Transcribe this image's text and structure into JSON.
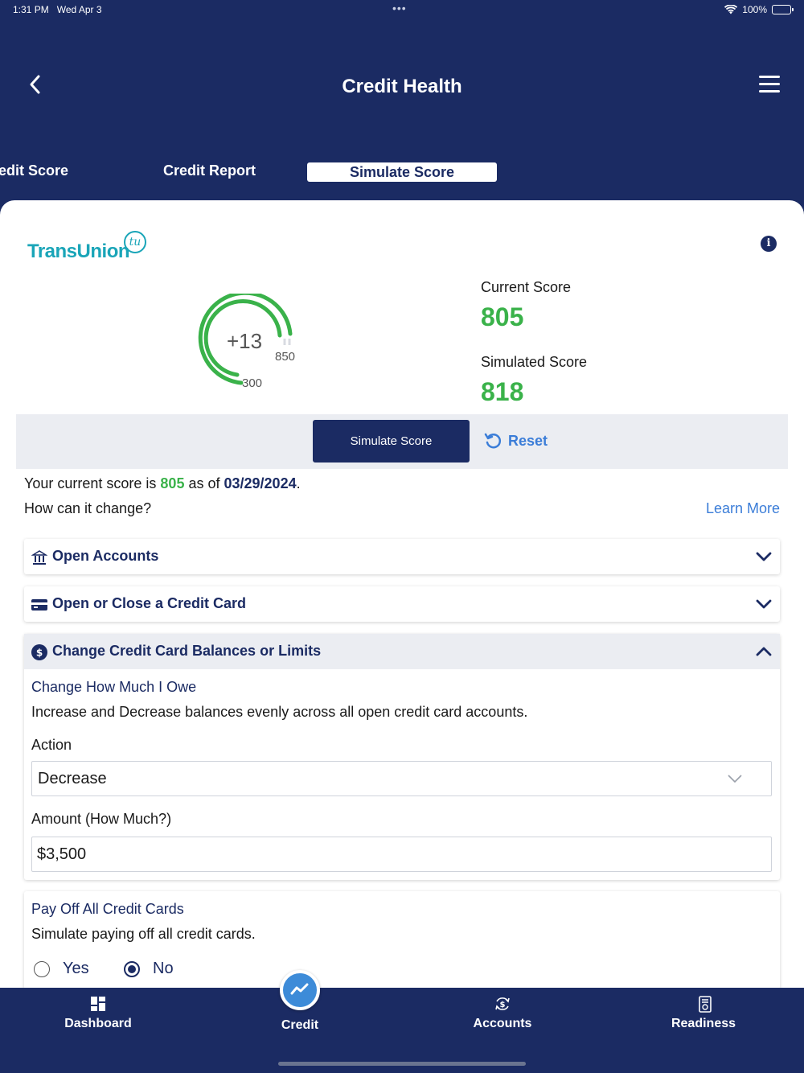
{
  "status": {
    "time": "1:31 PM",
    "date": "Wed Apr 3",
    "battery": "100%"
  },
  "header": {
    "title": "Credit Health"
  },
  "tabs": [
    {
      "label": "Credit Score"
    },
    {
      "label": "Credit Report"
    },
    {
      "label": "Simulate Score"
    }
  ],
  "brand": {
    "name": "TransUnion",
    "badge": "tu",
    "color": "#1aa5b8"
  },
  "gauge": {
    "delta": "+13",
    "max": "850",
    "min": "300"
  },
  "scores": {
    "current_label": "Current Score",
    "current_value": "805",
    "simulated_label": "Simulated Score",
    "simulated_value": "818"
  },
  "actions": {
    "simulate": "Simulate Score",
    "reset": "Reset"
  },
  "summary": {
    "prefix": "Your current score is ",
    "score": "805",
    "middle": " as of ",
    "date": "03/29/2024",
    "suffix": ".",
    "question": "How can it change?",
    "learn_more": "Learn More"
  },
  "accordions": {
    "open_accounts": "Open Accounts",
    "open_close_card": "Open or Close a Credit Card",
    "balances_limits": "Change Credit Card Balances or Limits"
  },
  "owe": {
    "title": "Change How Much I Owe",
    "description": "Increase and Decrease balances evenly across all open credit card accounts.",
    "action_label": "Action",
    "action_value": "Decrease",
    "amount_label": "Amount (How Much?)",
    "amount_value": "$3,500"
  },
  "payoff": {
    "title": "Pay Off All Credit Cards",
    "description": "Simulate paying off all credit cards.",
    "yes": "Yes",
    "no": "No",
    "selected": "No"
  },
  "nav": {
    "dashboard": "Dashboard",
    "credit": "Credit",
    "accounts": "Accounts",
    "readiness": "Readiness"
  },
  "colors": {
    "navy": "#1b2b63",
    "green": "#3ab24a",
    "link": "#3b7dd8"
  }
}
